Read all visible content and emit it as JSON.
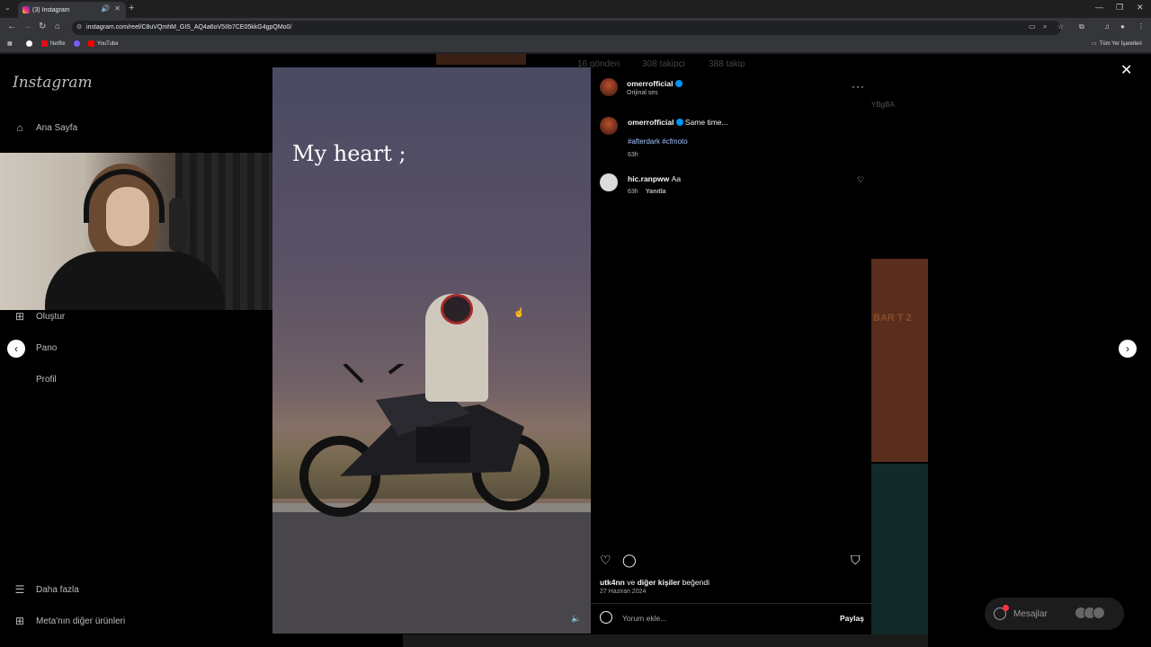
{
  "browser": {
    "tab_title": "(3) Instagram",
    "url": "instagram.com/reel/C8uVQmhM_GIS_AQ4a6oV5IIb7CE05kkG4gpQMo0/",
    "bookmarks": [
      "Netflix",
      "YouTube"
    ],
    "bookmarks_right": "Tüm Yer İşaretleri"
  },
  "sidebar": {
    "logo": "Instagram",
    "items": [
      {
        "label": "Ana Sayfa",
        "icon": "home-icon"
      },
      {
        "label": "Oluştur",
        "icon": "plus-square-icon"
      },
      {
        "label": "Pano",
        "icon": "dashboard-icon"
      },
      {
        "label": "Profil",
        "icon": "profile-icon"
      },
      {
        "label": "Daha fazla",
        "icon": "menu-icon"
      },
      {
        "label": "Meta'nın diğer ürünleri",
        "icon": "meta-icon"
      }
    ]
  },
  "background_profile": {
    "posts": "16 gönderi",
    "followers": "308 takipçi",
    "following": "388 takip",
    "side_text": "YBgBA",
    "thumb_text": "BAR T 2"
  },
  "video": {
    "caption": "My heart ;"
  },
  "post": {
    "username": "omerrofficial",
    "audio": "Orijinal ses",
    "caption_user": "omerrofficial",
    "caption_text": "Same time...",
    "hashtags": "#afterdark #cfmoto",
    "caption_time": "63h",
    "comment": {
      "user": "hic.ranpww",
      "text": "Aa",
      "time": "63h",
      "reply": "Yanıtla"
    },
    "likes_users": "utk4nn",
    "likes_connector": "ve",
    "likes_others": "diğer kişiler",
    "likes_suffix": "beğendi",
    "date": "27 Haziran 2024",
    "comment_placeholder": "Yorum ekle...",
    "share_label": "Paylaş"
  },
  "messages": {
    "label": "Mesajlar",
    "badge": "3"
  },
  "colors": {
    "verified": "#0095f6",
    "hashtag": "#a0c4ff",
    "badge": "#ff3040"
  }
}
